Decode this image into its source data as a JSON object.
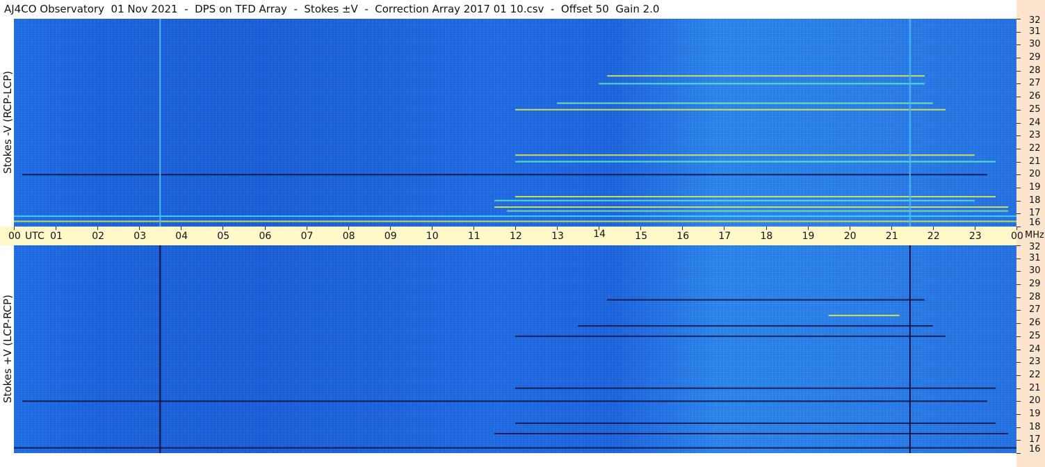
{
  "title": "AJ4CO Observatory  01 Nov 2021  -  DPS on TFD Array  -  Stokes ±V  -  Correction Array 2017 01 10.csv  -  Offset 50  Gain 2.0",
  "colors": {
    "background_blue": "#1e6fe6",
    "time_strip": "#fff8c8",
    "freq_strip": "#fde4cc",
    "hot_yellow": "#e8f040",
    "hot_cyan": "#40e0ff",
    "dark_line": "#101040"
  },
  "chart_data": [
    {
      "type": "heatmap",
      "panel": "top",
      "ylabel": "Stokes -V (RCP-LCP)",
      "xlabel": "UTC",
      "x_ticks": [
        "00",
        "01",
        "02",
        "03",
        "04",
        "05",
        "06",
        "07",
        "08",
        "09",
        "10",
        "11",
        "12",
        "13",
        "14",
        "15",
        "16",
        "17",
        "18",
        "19",
        "20",
        "21",
        "22",
        "23",
        "00"
      ],
      "xlim": [
        0,
        24
      ],
      "y_unit": "MHz",
      "y_ticks": [
        16,
        17,
        18,
        19,
        20,
        21,
        22,
        23,
        24,
        25,
        26,
        27,
        28,
        29,
        30,
        31,
        32
      ],
      "ylim": [
        16,
        32
      ],
      "vertical_lines_utc": [
        3.5,
        21.45
      ],
      "vertical_line_color": "#48b8ff",
      "bands": [
        {
          "freq": 27.6,
          "start": 14.2,
          "end": 21.8,
          "color": "#e8f040"
        },
        {
          "freq": 27.0,
          "start": 14.0,
          "end": 21.8,
          "color": "#60f0c0"
        },
        {
          "freq": 25.5,
          "start": 13.0,
          "end": 22.0,
          "color": "#80f0a0"
        },
        {
          "freq": 25.0,
          "start": 12.0,
          "end": 22.3,
          "color": "#e8f040"
        },
        {
          "freq": 21.5,
          "start": 12.0,
          "end": 23.0,
          "color": "#e8f040"
        },
        {
          "freq": 21.0,
          "start": 12.0,
          "end": 23.5,
          "color": "#60f0c0"
        },
        {
          "freq": 20.0,
          "start": 0.2,
          "end": 23.3,
          "color": "#101040"
        },
        {
          "freq": 18.3,
          "start": 12.0,
          "end": 23.5,
          "color": "#e8f040"
        },
        {
          "freq": 18.0,
          "start": 11.5,
          "end": 23.0,
          "color": "#60f0c0"
        },
        {
          "freq": 17.5,
          "start": 11.5,
          "end": 23.8,
          "color": "#e8f040"
        },
        {
          "freq": 17.2,
          "start": 11.8,
          "end": 23.8,
          "color": "#80f0a0"
        },
        {
          "freq": 16.8,
          "start": 0.0,
          "end": 24.0,
          "color": "#40e0ff"
        },
        {
          "freq": 16.4,
          "start": 0.0,
          "end": 24.0,
          "color": "#e8f040"
        }
      ]
    },
    {
      "type": "heatmap",
      "panel": "bottom",
      "ylabel": "Stokes +V (LCP-RCP)",
      "xlabel": "UTC",
      "x_ticks": [
        "00",
        "01",
        "02",
        "03",
        "04",
        "05",
        "06",
        "07",
        "08",
        "09",
        "10",
        "11",
        "12",
        "13",
        "14",
        "15",
        "16",
        "17",
        "18",
        "19",
        "20",
        "21",
        "22",
        "23",
        "00"
      ],
      "xlim": [
        0,
        24
      ],
      "y_unit": "MHz",
      "y_ticks": [
        16,
        17,
        18,
        19,
        20,
        21,
        22,
        23,
        24,
        25,
        26,
        27,
        28,
        29,
        30,
        31,
        32
      ],
      "ylim": [
        16,
        32
      ],
      "vertical_lines_utc": [
        3.5,
        21.45
      ],
      "vertical_line_color": "#101040",
      "bands": [
        {
          "freq": 27.8,
          "start": 14.2,
          "end": 21.8,
          "color": "#101040"
        },
        {
          "freq": 26.6,
          "start": 19.5,
          "end": 21.2,
          "color": "#e8f040"
        },
        {
          "freq": 25.8,
          "start": 13.5,
          "end": 22.0,
          "color": "#101040"
        },
        {
          "freq": 25.0,
          "start": 12.0,
          "end": 22.3,
          "color": "#101040"
        },
        {
          "freq": 21.0,
          "start": 12.0,
          "end": 23.5,
          "color": "#101040"
        },
        {
          "freq": 20.0,
          "start": 0.2,
          "end": 23.3,
          "color": "#101040"
        },
        {
          "freq": 18.3,
          "start": 12.0,
          "end": 23.5,
          "color": "#101040"
        },
        {
          "freq": 17.5,
          "start": 11.5,
          "end": 23.8,
          "color": "#101040"
        },
        {
          "freq": 16.4,
          "start": 0.0,
          "end": 24.0,
          "color": "#101040"
        }
      ]
    }
  ],
  "axis": {
    "utc_label": "UTC",
    "mhz_label": "MHz"
  }
}
